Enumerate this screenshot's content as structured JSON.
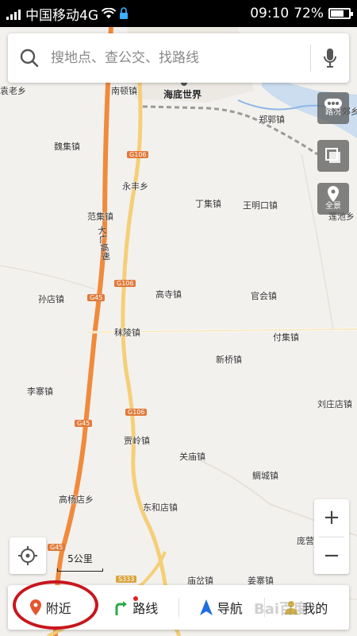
{
  "status_bar": {
    "carrier": "中国移动4G",
    "time": "09:10",
    "battery": "72%",
    "battery_level": 0.72
  },
  "search": {
    "placeholder": "搜地点、查公交、找路线"
  },
  "controls": {
    "traffic_label": "路况",
    "panorama_label": "全景"
  },
  "map": {
    "places": [
      {
        "id": "nandun",
        "name": "南顿镇"
      },
      {
        "id": "haidi",
        "name": "海底世界"
      },
      {
        "id": "yuan",
        "name": "袁老乡"
      },
      {
        "id": "zhengguo",
        "name": "郑郭镇"
      },
      {
        "id": "beijiao",
        "name": "北郊乡"
      },
      {
        "id": "weiji",
        "name": "魏集镇"
      },
      {
        "id": "yongfeng",
        "name": "永丰乡"
      },
      {
        "id": "dingji",
        "name": "丁集镇"
      },
      {
        "id": "wangmingkou",
        "name": "王明口镇"
      },
      {
        "id": "lianchi",
        "name": "莲池乡"
      },
      {
        "id": "fanji",
        "name": "范集镇"
      },
      {
        "id": "gaosi",
        "name": "高寺镇"
      },
      {
        "id": "guanhui",
        "name": "官会镇"
      },
      {
        "id": "sundian",
        "name": "孙店镇"
      },
      {
        "id": "moling",
        "name": "秣陵镇"
      },
      {
        "id": "fuji",
        "name": "付集镇"
      },
      {
        "id": "xinqiao",
        "name": "新桥镇"
      },
      {
        "id": "lizhai",
        "name": "李寨镇"
      },
      {
        "id": "liuzhuangdian",
        "name": "刘庄店镇"
      },
      {
        "id": "jialing",
        "name": "贾岭镇"
      },
      {
        "id": "guanmiao",
        "name": "关庙镇"
      },
      {
        "id": "lucheng",
        "name": "鲷城镇"
      },
      {
        "id": "gaoyangdian",
        "name": "高杨店乡"
      },
      {
        "id": "donghedian",
        "name": "东和店镇"
      },
      {
        "id": "pangying",
        "name": "庞营"
      },
      {
        "id": "miaocha",
        "name": "庙岔镇"
      },
      {
        "id": "jiangzhai",
        "name": "姜寨镇"
      }
    ],
    "road_shields": [
      "G106",
      "G106",
      "G106",
      "G45",
      "G45",
      "G45",
      "S333"
    ],
    "highway_label": "大广高速",
    "scale_label": "5公里"
  },
  "nav": {
    "nearby": "附近",
    "route": "路线",
    "navigate": "导航",
    "mine": "我的"
  },
  "watermark": "Bai百度",
  "colors": {
    "highway": "#f08a3c",
    "national_road": "#f5cf78",
    "annotation": "#c8161d",
    "nav_arrow": "#1e6fe0",
    "route_icon": "#2aa84a",
    "nearby_pin": "#e4562f"
  }
}
